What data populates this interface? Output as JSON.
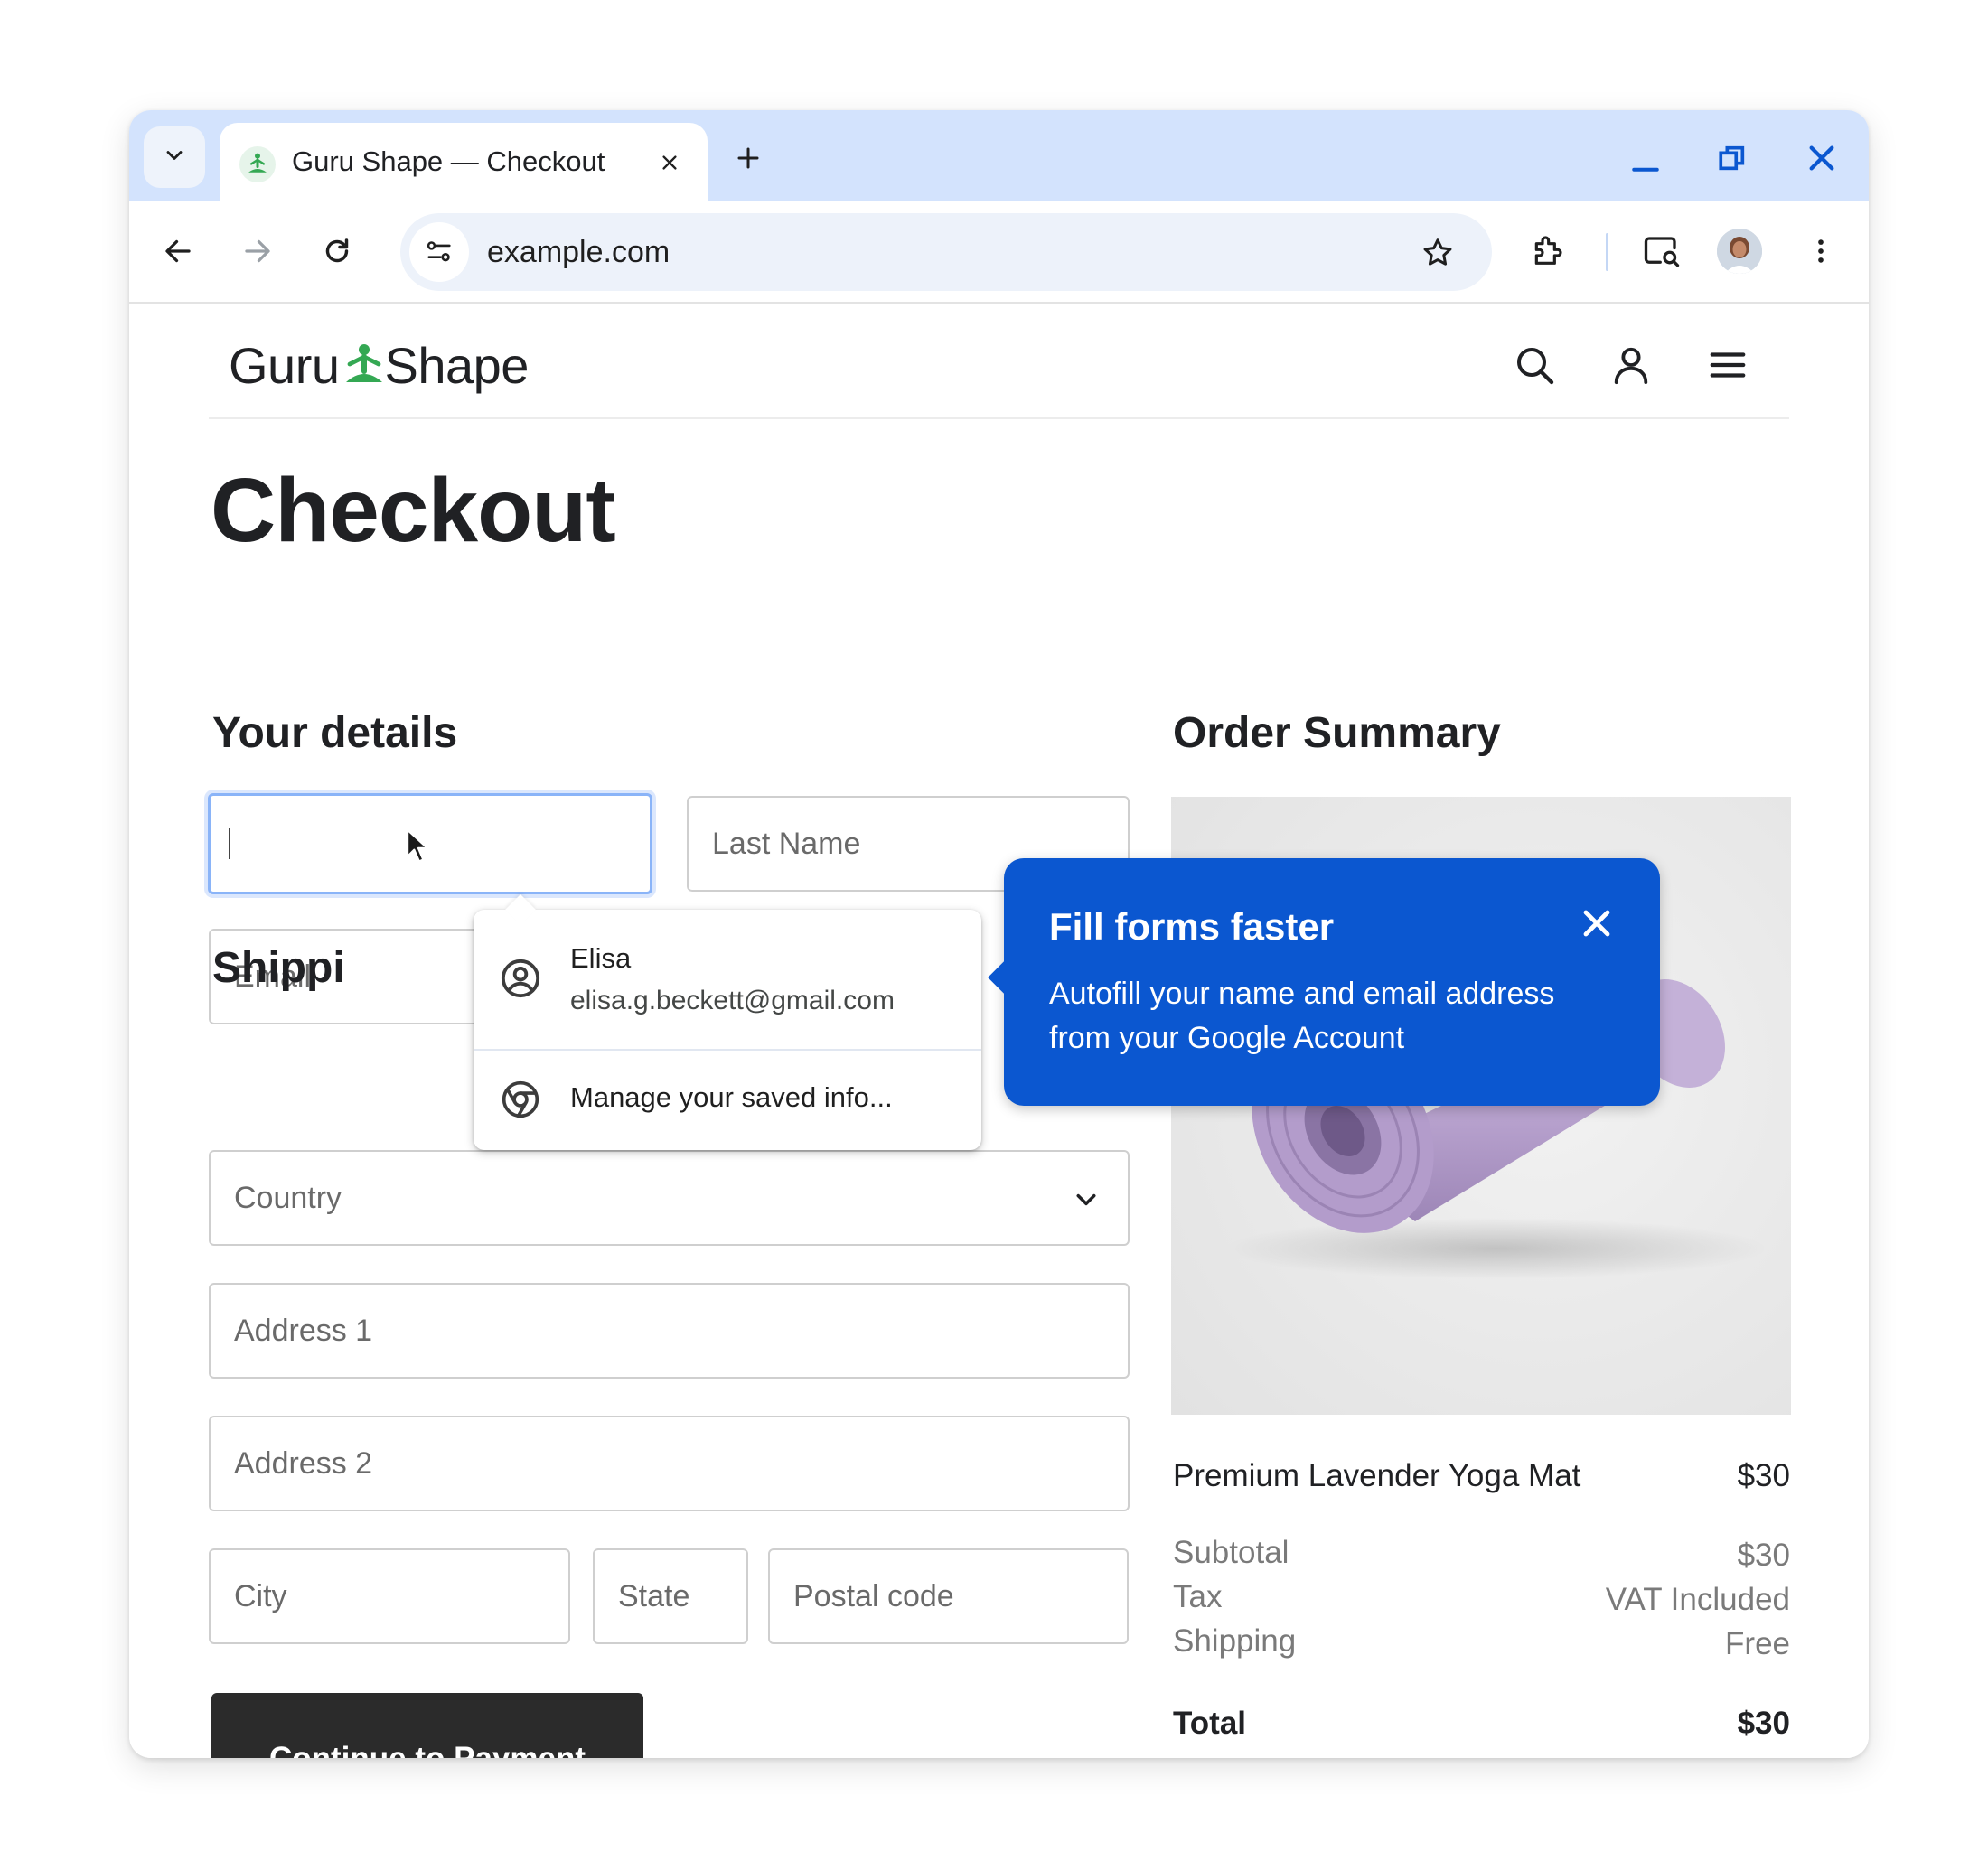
{
  "browser": {
    "tab": {
      "title": "Guru Shape — Checkout"
    },
    "url": "example.com"
  },
  "site": {
    "logo": {
      "left": "Guru",
      "right": "Shape"
    }
  },
  "checkout": {
    "title": "Checkout",
    "details_heading": "Your details",
    "first_name_value": "",
    "last_name_placeholder": "Last Name",
    "email_placeholder": "Email",
    "shipping_heading": "Shippi",
    "country_placeholder": "Country",
    "address1_placeholder": "Address 1",
    "address2_placeholder": "Address 2",
    "city_placeholder": "City",
    "state_placeholder": "State",
    "postal_placeholder": "Postal code",
    "continue_label": "Continue to Payment"
  },
  "autofill": {
    "profile_name": "Elisa",
    "profile_email": "elisa.g.beckett@gmail.com",
    "manage_label": "Manage your saved info..."
  },
  "promo": {
    "title": "Fill forms faster",
    "body": "Autofill your name and email address from your Google Account"
  },
  "order": {
    "heading": "Order Summary",
    "product_name": "Premium Lavender Yoga Mat",
    "product_price": "$30",
    "rows": [
      {
        "label": "Subtotal",
        "value": "$30"
      },
      {
        "label": "Tax",
        "value": "VAT Included"
      },
      {
        "label": "Shipping",
        "value": "Free"
      }
    ],
    "total_label": "Total",
    "total_value": "$30"
  },
  "colors": {
    "tab_strip": "#d3e3fd",
    "accent_blue": "#0b57d0",
    "brand_green": "#34a853",
    "button_dark": "#2b2b2b",
    "product": "#b9a3cf"
  }
}
